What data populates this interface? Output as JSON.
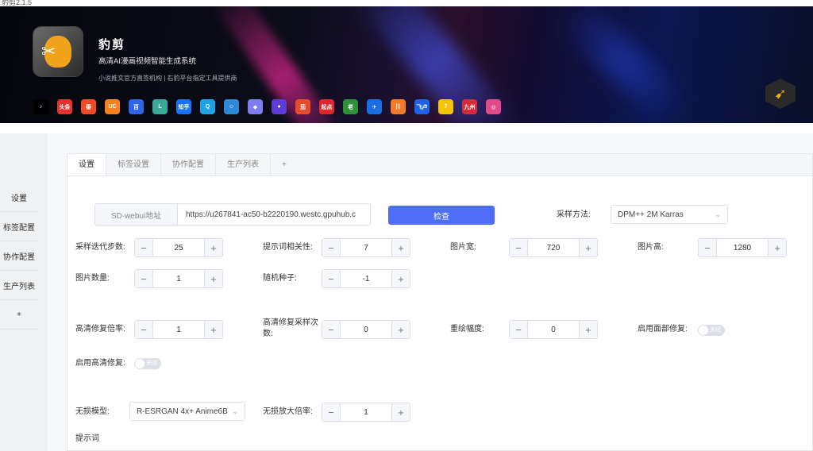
{
  "window_title": "豹剪2.1.5",
  "banner": {
    "app_name": "豹剪",
    "subtitle": "高清AI漫画视频智能生成系统",
    "tagline": "小说推文官方直签机构 | 右豹平台指定工具提供商",
    "platform_icons": [
      {
        "name": "tiktok-icon",
        "label": "♪",
        "color": "#000000"
      },
      {
        "name": "toutiao-icon",
        "label": "头条",
        "color": "#e8322c"
      },
      {
        "name": "fanqie-icon",
        "label": "番",
        "color": "#f04b26"
      },
      {
        "name": "uc-icon",
        "label": "UC",
        "color": "#f5821f"
      },
      {
        "name": "baidu-icon",
        "label": "百",
        "color": "#2f63e8"
      },
      {
        "name": "app-l-icon",
        "label": "L",
        "color": "#3aa89b"
      },
      {
        "name": "zhihu-icon",
        "label": "知乎",
        "color": "#1772f6"
      },
      {
        "name": "qq-icon",
        "label": "Q",
        "color": "#1fa1e8"
      },
      {
        "name": "app-face-icon",
        "label": "☺",
        "color": "#2e8ad6"
      },
      {
        "name": "app-cube-icon",
        "label": "◆",
        "color": "#7e7ef2"
      },
      {
        "name": "app-circle-icon",
        "label": "●",
        "color": "#5b3cd6"
      },
      {
        "name": "tomato-icon",
        "label": "茄",
        "color": "#e84a2c"
      },
      {
        "name": "qidian-icon",
        "label": "起点",
        "color": "#e0262d"
      },
      {
        "name": "app-lao-icon",
        "label": "老",
        "color": "#2f8f3a"
      },
      {
        "name": "app-bird-icon",
        "label": "✈",
        "color": "#1a6fe0"
      },
      {
        "name": "app-stripes-icon",
        "label": "|||",
        "color": "#f07a2a"
      },
      {
        "name": "feilu-icon",
        "label": "飞卢",
        "color": "#2062e6"
      },
      {
        "name": "qimao-icon",
        "label": "7",
        "color": "#f5c40a"
      },
      {
        "name": "jiuzhou-icon",
        "label": "九州",
        "color": "#d42a3a"
      },
      {
        "name": "app-pink-icon",
        "label": "◎",
        "color": "#e04a8a"
      }
    ]
  },
  "sidebar": {
    "items": [
      {
        "label": "设置"
      },
      {
        "label": "标签配置"
      },
      {
        "label": "协作配置"
      },
      {
        "label": "生产列表"
      },
      {
        "label": "+"
      }
    ]
  },
  "tabs": [
    {
      "label": "设置",
      "active": true
    },
    {
      "label": "标签设置",
      "active": false
    },
    {
      "label": "协作配置",
      "active": false
    },
    {
      "label": "生产列表",
      "active": false
    },
    {
      "label": "+",
      "active": false
    }
  ],
  "form": {
    "sd_label": "SD-webui地址",
    "sd_url": "https://u267841-ac50-b2220190.westc.gpuhub.c",
    "check_button": "检查",
    "sampler_label": "采样方法:",
    "sampler_value": "DPM++ 2M Karras",
    "steps_label": "采样迭代步数:",
    "steps_value": "25",
    "cfg_label": "提示词相关性:",
    "cfg_value": "7",
    "width_label": "图片宽:",
    "width_value": "720",
    "height_label": "图片高:",
    "height_value": "1280",
    "count_label": "图片数量:",
    "count_value": "1",
    "seed_label": "随机种子:",
    "seed_value": "-1",
    "hr_scale_label": "高清修复倍率:",
    "hr_scale_value": "1",
    "hr_steps_label": "高清修复采样次数:",
    "hr_steps_value": "0",
    "denoise_label": "重绘幅度:",
    "denoise_value": "0",
    "face_restore_label": "启用面部修复:",
    "face_restore_state": "关闭",
    "hires_label": "启用高清修复:",
    "hires_state": "关闭",
    "upscaler_label": "无损模型:",
    "upscaler_value": "R-ESRGAN 4x+ Anime6B",
    "upscale_ratio_label": "无损放大倍率:",
    "upscale_ratio_value": "1",
    "prompt_label": "提示词"
  },
  "colors": {
    "accent": "#4f6ef7",
    "sidebar_bg": "#f0f1f3"
  }
}
